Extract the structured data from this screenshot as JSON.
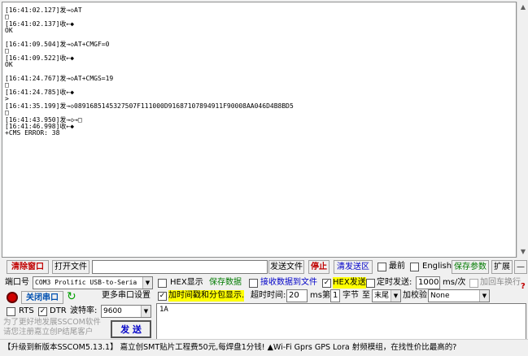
{
  "log": {
    "lines": [
      "[16:41:02.127]发→◇AT",
      "□",
      "[16:41:02.137]收←◆",
      "OK",
      "",
      "[16:41:09.504]发→◇AT+CMGF=0",
      "□",
      "[16:41:09.522]收←◆",
      "OK",
      "",
      "[16:41:24.767]发→◇AT+CMGS=19",
      "□",
      "[16:41:24.785]收←◆",
      ">",
      "[16:41:35.199]发→◇0891685145327507F111000D91687107894911F90008AA046D4B8BD5",
      "□",
      "[16:41:43.950]发→◇→□",
      "[16:41:46.998]收←◆",
      "+CMS ERROR: 38"
    ]
  },
  "toolbar": {
    "clear_window": "清除窗口",
    "open_file": "打开文件",
    "file_path": "",
    "send_file": "发送文件",
    "stop": "停止",
    "clear_send_area": "清发送区",
    "topmost": "最前",
    "english": "English",
    "save_params": "保存参数",
    "expand": "扩展",
    "collapse": "—"
  },
  "port": {
    "label": "端口号",
    "value": "COM3 Prolific USB-to-Seria",
    "close_port": "关闭串口",
    "more_settings": "更多串口设置",
    "rts": "RTS",
    "dtr": "DTR",
    "baud_label": "波特率:",
    "baud_value": "9600"
  },
  "options": {
    "hex_display": "HEX显示",
    "save_data": "保存数据",
    "recv_to_file": "接收数据到文件",
    "hex_send": "HEX发送",
    "timed_send": "定时发送:",
    "interval": "1000",
    "interval_unit": "ms/次",
    "add_crlf": "加回车换行",
    "timestamp_split": "加时间戳和分包显示.",
    "timeout_label": "超时时间:",
    "timeout_value": "20",
    "timeout_unit": "ms",
    "byte_prefix": "第",
    "byte_index": "1",
    "byte_unit": "字节",
    "to": "至",
    "to_value": "末尾",
    "checksum_label": "加校验",
    "checksum_value": "None"
  },
  "send": {
    "content": "1A",
    "button": "发 送"
  },
  "promo": "为了更好地发展SSCOM软件\n请您注册嘉立创P结尾客户",
  "status": "【升级到新版本SSCOM5.13.1】 嘉立创SMT贴片工程费50元,每焊盘1分钱! ▲Wi-Fi Gprs GPS Lora 射频模组，在找性价比最高的?"
}
